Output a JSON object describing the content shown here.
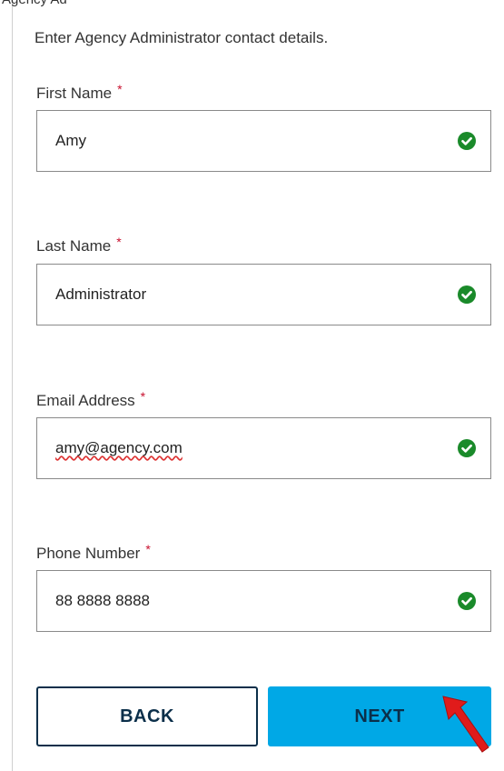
{
  "header": {
    "cut_title": "Agency Ad"
  },
  "form": {
    "intro": "Enter Agency Administrator contact details.",
    "required_marker": "*",
    "fields": [
      {
        "label": "First Name",
        "value": "Amy"
      },
      {
        "label": "Last Name",
        "value": "Administrator"
      },
      {
        "label": "Email Address",
        "value": "amy@agency.com"
      },
      {
        "label": "Phone Number",
        "value": "88 8888 8888"
      }
    ]
  },
  "buttons": {
    "back": "BACK",
    "next": "NEXT"
  },
  "colors": {
    "accent": "#00a8e6",
    "navy": "#0b2f4a",
    "valid": "#1a8a2a",
    "required": "#c8102e",
    "cursor": "#e01b1b"
  },
  "icons": {
    "valid": "check-circle-icon",
    "pointer": "mouse-cursor-icon"
  }
}
